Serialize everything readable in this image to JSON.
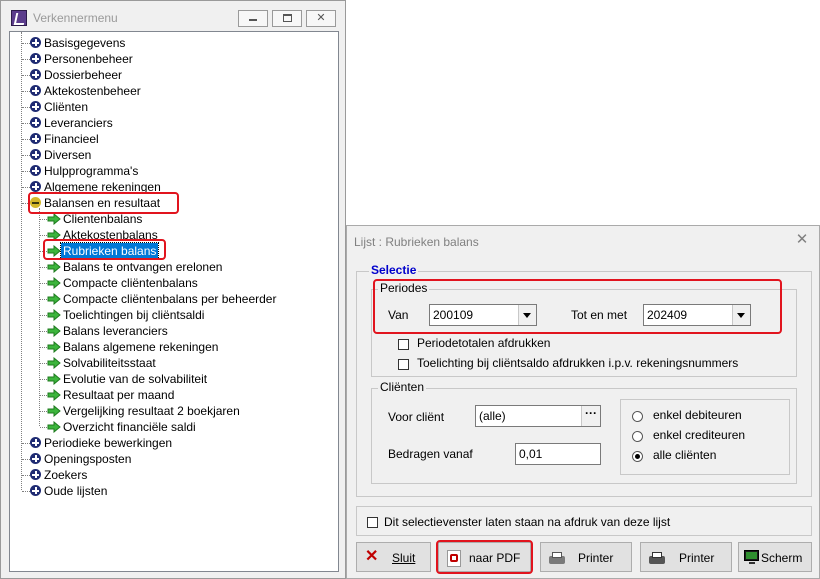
{
  "explorer": {
    "title": "Verkennermenu",
    "items": [
      {
        "label": "Basisgegevens",
        "icon": "plus-icon"
      },
      {
        "label": "Personenbeheer",
        "icon": "plus-icon"
      },
      {
        "label": "Dossierbeheer",
        "icon": "plus-icon"
      },
      {
        "label": "Aktekostenbeheer",
        "icon": "plus-icon"
      },
      {
        "label": "Cliënten",
        "icon": "plus-icon"
      },
      {
        "label": "Leveranciers",
        "icon": "plus-icon"
      },
      {
        "label": "Financieel",
        "icon": "plus-icon"
      },
      {
        "label": "Diversen",
        "icon": "plus-icon"
      },
      {
        "label": "Hulpprogramma's",
        "icon": "plus-icon"
      },
      {
        "label": "Algemene rekeningen",
        "icon": "plus-icon"
      },
      {
        "label": "Balansen en resultaat",
        "icon": "minus-icon",
        "expanded": true,
        "children": [
          {
            "label": "Clientenbalans"
          },
          {
            "label": "Aktekostenbalans"
          },
          {
            "label": "Rubrieken balans",
            "selected": true
          },
          {
            "label": "Balans te ontvangen erelonen"
          },
          {
            "label": "Compacte cliëntenbalans"
          },
          {
            "label": "Compacte cliëntenbalans per beheerder"
          },
          {
            "label": "Toelichtingen bij cliëntsaldi"
          },
          {
            "label": "Balans leveranciers"
          },
          {
            "label": "Balans algemene rekeningen"
          },
          {
            "label": "Solvabiliteitsstaat"
          },
          {
            "label": "Evolutie van de solvabiliteit"
          },
          {
            "label": "Resultaat per maand"
          },
          {
            "label": "Vergelijking resultaat 2 boekjaren"
          },
          {
            "label": "Overzicht financiële saldi"
          }
        ]
      },
      {
        "label": "Periodieke bewerkingen",
        "icon": "plus-icon"
      },
      {
        "label": "Openingsposten",
        "icon": "plus-icon"
      },
      {
        "label": "Zoekers",
        "icon": "plus-icon"
      },
      {
        "label": "Oude lijsten",
        "icon": "plus-icon"
      }
    ]
  },
  "dialog": {
    "title": "Lijst : Rubrieken balans",
    "selectie_label": "Selectie",
    "periodes": {
      "label": "Periodes",
      "van_label": "Van",
      "van_value": "200109",
      "totenmet_label": "Tot en met",
      "totenmet_value": "202409",
      "periodetotalen_label": "Periodetotalen afdrukken",
      "toelichting_label": "Toelichting bij cliëntsaldo afdrukken i.p.v. rekeningsnummers"
    },
    "clienten": {
      "label": "Cliënten",
      "voor_client_label": "Voor cliënt",
      "voor_client_value": "(alle)",
      "bedragen_label": "Bedragen vanaf",
      "bedragen_value": "0,01",
      "radio_options": [
        "enkel debiteuren",
        "enkel crediteuren",
        "alle cliënten"
      ],
      "radio_selected": "alle cliënten"
    },
    "keep_open_label": "Dit selectievenster laten staan na afdruk van deze lijst",
    "buttons": {
      "sluit": "Sluit",
      "pdf": "naar PDF",
      "printer1": "Printer",
      "printer2": "Printer",
      "scherm": "Scherm"
    }
  },
  "colors": {
    "highlight_box": "#e1141e",
    "selection": "#0078d7",
    "plus_icon": "#1f2b73",
    "selectie_title": "#0000cc"
  }
}
